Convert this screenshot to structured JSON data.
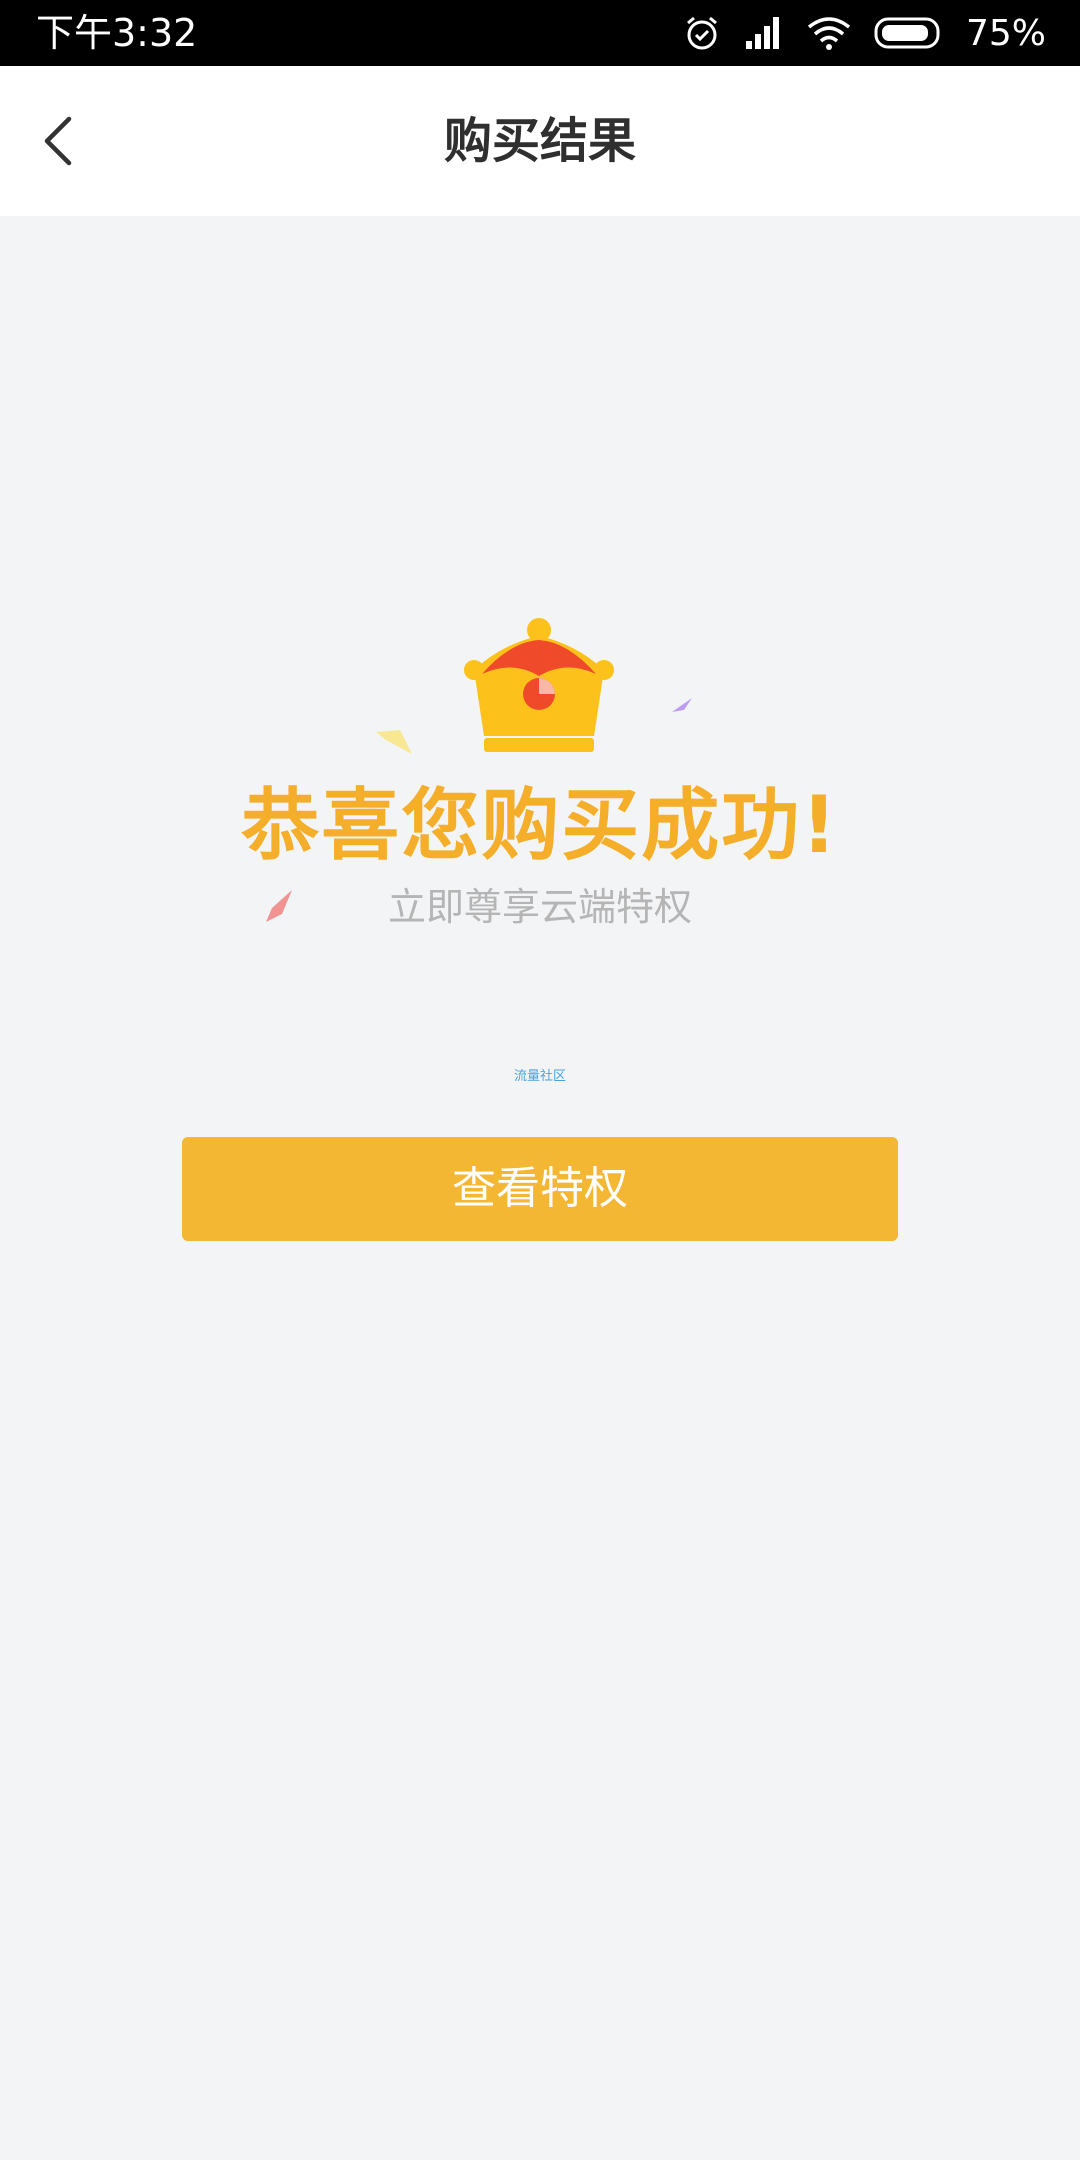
{
  "status_bar": {
    "time": "下午3:32",
    "battery": "75%",
    "icons": [
      "alarm-icon",
      "signal-icon",
      "wifi-icon",
      "battery-icon"
    ]
  },
  "nav": {
    "back_icon": "chevron-left-icon",
    "title": "购买结果"
  },
  "result": {
    "crown_icon": "crown-icon",
    "headline": "恭喜您购买成功!",
    "subline": "立即尊享云端特权",
    "watermark": "流量社区",
    "button_label": "查看特权"
  },
  "colors": {
    "accent": "#f4b733",
    "headline": "#f5ae2a",
    "background": "#f3f4f6",
    "crown_gold": "#fcc21b",
    "crown_red": "#ef4b2b"
  }
}
